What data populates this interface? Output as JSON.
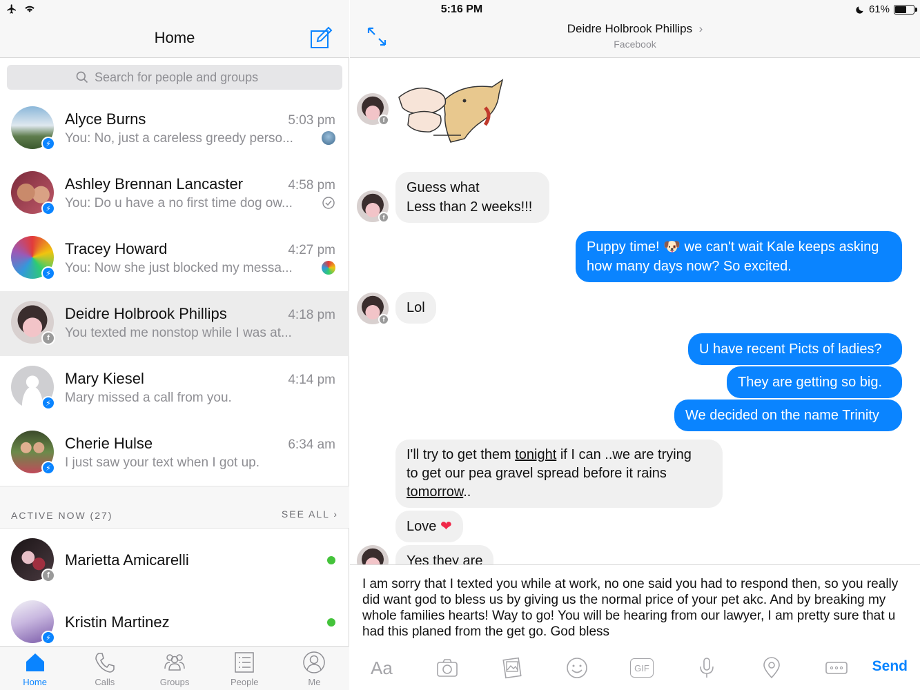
{
  "status": {
    "time": "5:16 PM",
    "battery": "61%",
    "battery_level": 0.61
  },
  "left": {
    "title": "Home",
    "search": {
      "placeholder": "Search for people and groups"
    },
    "conversations": [
      {
        "name": "Alyce Burns",
        "time": "5:03 pm",
        "preview": "You: No, just a careless greedy perso...",
        "badge": "messenger",
        "avatar_color": "#5b8fb3"
      },
      {
        "name": "Ashley Brennan Lancaster",
        "time": "4:58 pm",
        "preview": "You: Do u have a no first time dog ow...",
        "badge": "messenger",
        "avatar_color": "#b0545a"
      },
      {
        "name": "Tracey Howard",
        "time": "4:27 pm",
        "preview": "You: Now she just blocked my messa...",
        "badge": "messenger",
        "avatar_color": "#e6b400"
      },
      {
        "name": "Deidre Holbrook Phillips",
        "time": "4:18 pm",
        "preview": "You texted me nonstop while I was at...",
        "badge": "facebook",
        "avatar_color": "#6b5b5b"
      },
      {
        "name": "Mary Kiesel",
        "time": "4:14 pm",
        "preview": "Mary missed a call from you.",
        "badge": "messenger",
        "avatar_color": "#d0d0d0"
      },
      {
        "name": "Cherie Hulse",
        "time": "6:34 am",
        "preview": "I just saw your text when I got up.",
        "badge": "messenger",
        "avatar_color": "#7b9c5a"
      }
    ],
    "active_now": {
      "title": "ACTIVE NOW (27)",
      "see_all": "SEE ALL",
      "people": [
        {
          "name": "Marietta Amicarelli",
          "badge": "facebook",
          "avatar_color": "#3a2a30"
        },
        {
          "name": "Kristin Martinez",
          "badge": "messenger",
          "avatar_color": "#a58ac8"
        }
      ]
    },
    "tabs": [
      {
        "label": "Home",
        "icon": "home-icon",
        "active": true
      },
      {
        "label": "Calls",
        "icon": "phone-icon",
        "active": false
      },
      {
        "label": "Groups",
        "icon": "groups-icon",
        "active": false
      },
      {
        "label": "People",
        "icon": "people-list-icon",
        "active": false
      },
      {
        "label": "Me",
        "icon": "profile-icon",
        "active": false
      }
    ]
  },
  "chat": {
    "contact_name": "Deidre Holbrook Phillips",
    "contact_source": "Facebook",
    "messages": {
      "m1": "Guess what",
      "m1b": "Less than 2 weeks!!!",
      "m2a": "Puppy time! ",
      "m2b": " we can't wait Kale keeps asking",
      "m2c": "how many days now? So excited.",
      "m3": "Lol",
      "m4": "U have recent Picts of ladies?",
      "m5": "They are getting so big.",
      "m6": "We decided on the name Trinity",
      "m7a": "I'll try to get them ",
      "m7b": "tonight",
      "m7c": " if I can ..we are trying",
      "m7d": "to get our pea gravel spread before it rains",
      "m7e": "tomorrow",
      "m7f": "..",
      "m8": "Love ",
      "m9": "Yes they are"
    },
    "composer_text": "I am sorry that I texted you while at work, no one said you had to respond then, so you really did want god to bless us by giving us the normal price of your pet akc. And by breaking my whole families hearts! Way to go! You will be hearing from our lawyer, I am pretty sure that u had this planed from the get go. God bless",
    "tool_aa": "Aa",
    "tool_gif": "GIF",
    "send_label": "Send"
  }
}
